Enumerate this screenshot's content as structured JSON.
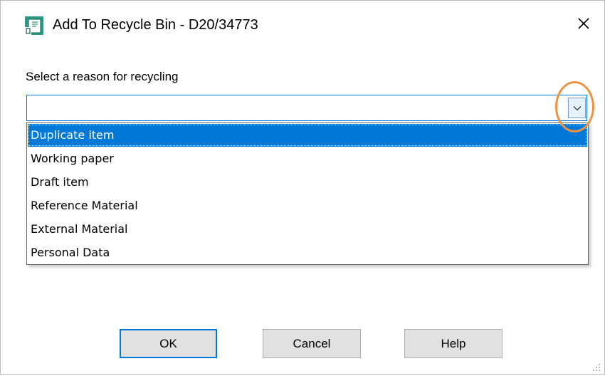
{
  "window": {
    "title": "Add To Recycle Bin - D20/34773",
    "app_icon": "recycle-document-icon",
    "close_glyph": "✕"
  },
  "form": {
    "reason_label": "Select a reason for recycling",
    "reason_value": "",
    "dropdown_icon": "chevron-down-icon"
  },
  "dropdown": {
    "options": [
      "Duplicate item",
      "Working paper",
      "Draft item",
      "Reference Material",
      "External Material",
      "Personal Data"
    ],
    "highlighted_index": 0
  },
  "buttons": {
    "ok": "OK",
    "cancel": "Cancel",
    "help": "Help"
  },
  "colors": {
    "accent": "#0078d7",
    "annotation_ring": "#ee9241"
  }
}
